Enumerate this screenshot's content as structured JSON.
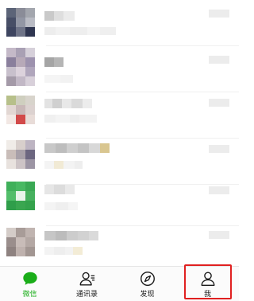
{
  "tabbar": {
    "tabs": [
      {
        "id": "chats",
        "label": "微信",
        "icon": "chat-bubble-icon",
        "active": true
      },
      {
        "id": "contacts",
        "label": "通讯录",
        "icon": "contacts-icon",
        "active": false
      },
      {
        "id": "discover",
        "label": "发现",
        "icon": "compass-icon",
        "active": false
      },
      {
        "id": "me",
        "label": "我",
        "icon": "person-icon",
        "active": false
      }
    ]
  },
  "colors": {
    "accent": "#1aad19",
    "highlight": "#e02020"
  }
}
